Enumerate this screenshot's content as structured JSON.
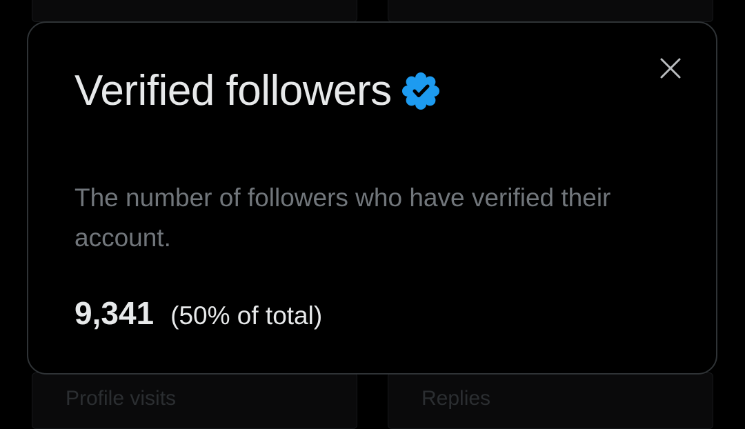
{
  "background": {
    "top_left_label": "",
    "top_right_label": "",
    "bottom_left_label": "Profile visits",
    "bottom_right_label": "Replies"
  },
  "modal": {
    "title": "Verified followers",
    "title_icon": "verified-badge-icon",
    "close_icon": "close-icon",
    "description": "The number of followers who have verified their account.",
    "stat_value": "9,341",
    "stat_share": "(50% of total)"
  },
  "colors": {
    "background": "#000000",
    "text_primary": "#e7e9ea",
    "text_secondary": "#71767b",
    "border": "#2f3336",
    "verified_blue": "#1d9bf0"
  }
}
